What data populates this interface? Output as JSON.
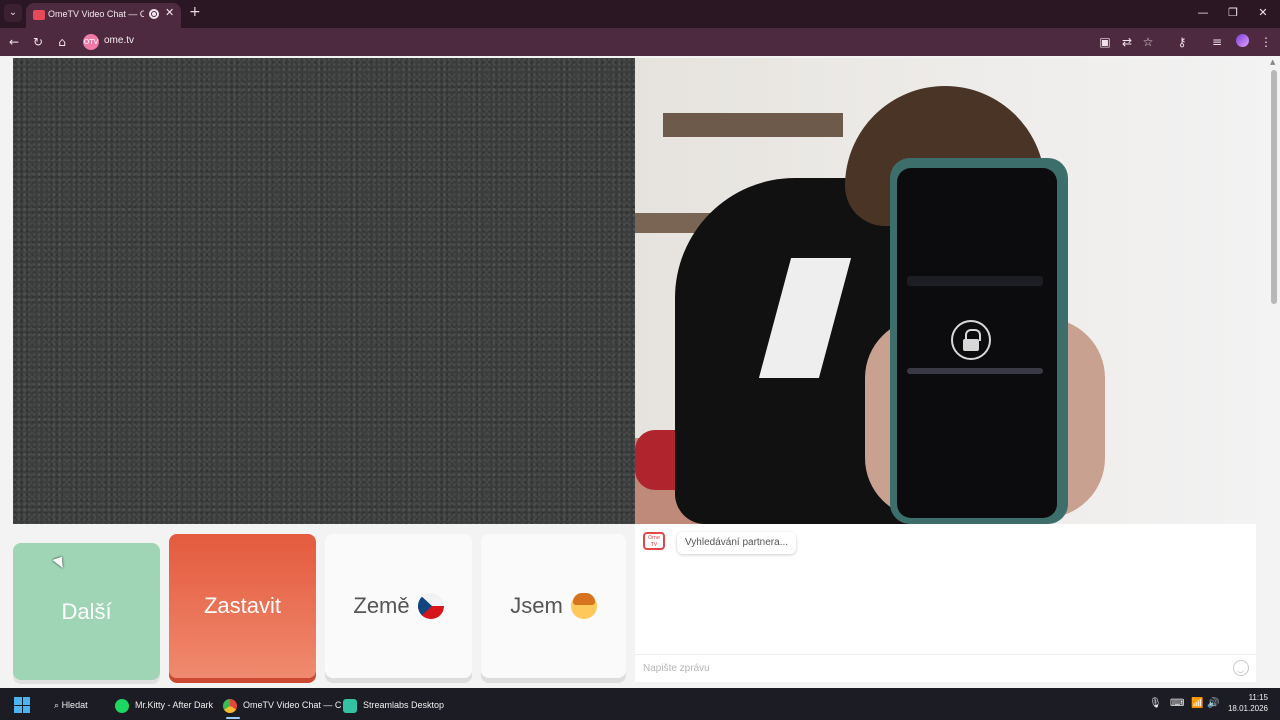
{
  "browser": {
    "tab": {
      "title": "OmeTV Video Chat — Ome",
      "close": "✕"
    },
    "new_tab": "+",
    "window": {
      "minimize": "—",
      "restore": "❐",
      "close": "✕"
    },
    "toolbar": {
      "url": "ome.tv",
      "site_badge": "OTV"
    }
  },
  "page": {
    "buttons": {
      "next": "Další",
      "stop": "Zastavit",
      "country": "Země",
      "gender": "Jsem"
    },
    "chat": {
      "logo_text": "Ome TV",
      "status_message": "Vyhledávání partnera...",
      "input_placeholder": "Napište zprávu"
    }
  },
  "taskbar": {
    "search": "Hledat",
    "apps": [
      {
        "label": "Mr.Kitty - After Dark",
        "color": "#1ed760"
      },
      {
        "label": "OmeTV Video Chat — C",
        "color": "#e8453c"
      },
      {
        "label": "Streamlabs Desktop",
        "color": "#31c3a2"
      }
    ],
    "time": "11:15",
    "date": "18.01.2026"
  }
}
